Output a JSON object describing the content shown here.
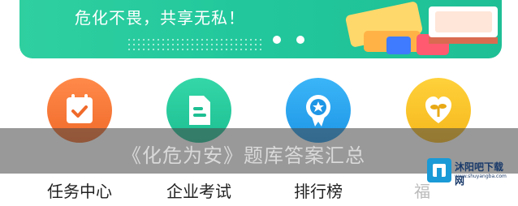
{
  "banner": {
    "slogan": "危化不畏，共享无私！",
    "page_indicator_count": 2
  },
  "menu": [
    {
      "label": "任务中心",
      "icon": "calendar-check-icon",
      "color": "#f47a3a"
    },
    {
      "label": "企业考试",
      "icon": "document-icon",
      "color": "#22c89c"
    },
    {
      "label": "排行榜",
      "icon": "medal-star-icon",
      "color": "#2aa7f0"
    },
    {
      "label": "福",
      "icon": "heart-plant-icon",
      "color": "#f7c22a"
    }
  ],
  "overlay": {
    "caption": "《化危为安》题库答案汇总"
  },
  "watermark": {
    "title": "沐阳吧下载网",
    "subtitle": "www.shuyangba.com",
    "color": "#1a9ad6"
  }
}
